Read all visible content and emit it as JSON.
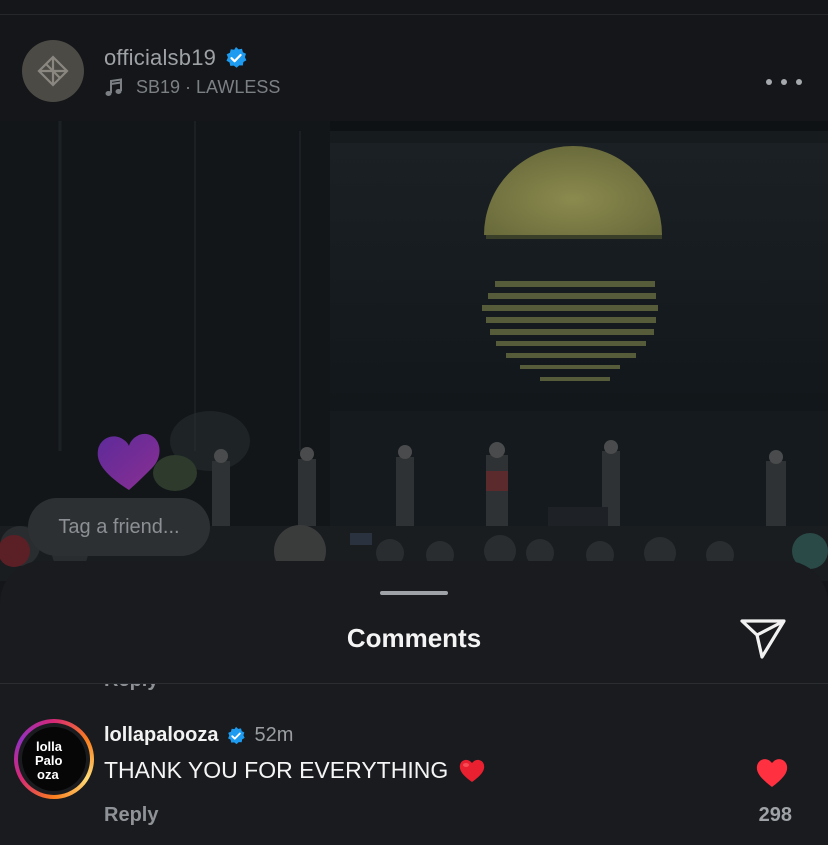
{
  "post": {
    "username": "officialsb19",
    "music": "SB19 · LAWLESS"
  },
  "overlay": {
    "tag_placeholder": "Tag a friend..."
  },
  "comments_sheet": {
    "title": "Comments",
    "prev_reply": "Reply",
    "comment": {
      "username": "lollapalooza",
      "time": "52m",
      "text": "THANK YOU FOR EVERYTHING",
      "reply": "Reply",
      "likes": "298"
    }
  },
  "colors": {
    "verified": "#1d9bf0",
    "like": "#ff3040"
  },
  "icons": [
    "verified-badge-icon",
    "music-note-icon",
    "more-options-icon",
    "heart-icon",
    "share-icon",
    "red-heart-emoji-icon"
  ]
}
